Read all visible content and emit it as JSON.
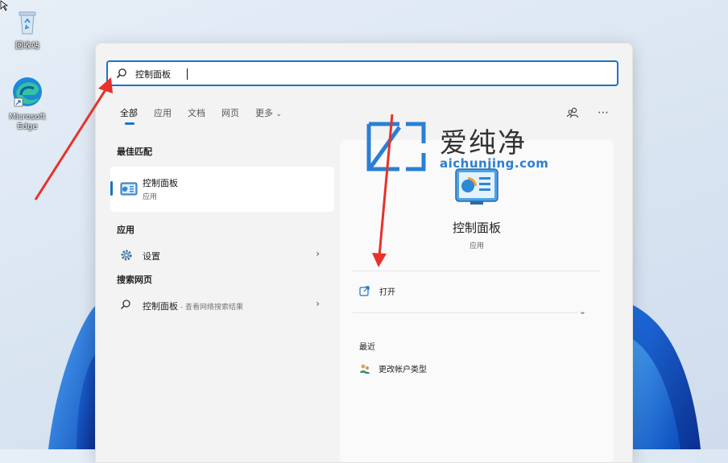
{
  "desktop": {
    "icons": [
      {
        "name": "recycle-bin",
        "label": "回收站"
      },
      {
        "name": "microsoft-edge",
        "label": "Microsoft Edge"
      }
    ]
  },
  "search": {
    "value": "控制面板",
    "icon": "search-icon"
  },
  "tabs": [
    {
      "label": "全部",
      "active": true
    },
    {
      "label": "应用"
    },
    {
      "label": "文档"
    },
    {
      "label": "网页"
    },
    {
      "label": "更多"
    }
  ],
  "toolbar": {
    "account_icon": "account-switch-icon",
    "more_icon": "more-options-icon"
  },
  "best_match": {
    "heading": "最佳匹配",
    "title": "控制面板",
    "subtitle": "应用"
  },
  "apps": {
    "heading": "应用",
    "items": [
      {
        "label": "设置",
        "icon": "gear-icon"
      }
    ]
  },
  "web": {
    "heading": "搜索网页",
    "items": [
      {
        "label": "控制面板",
        "sub": " - 查看网络搜索结果",
        "icon": "search-icon"
      }
    ]
  },
  "detail": {
    "title": "控制面板",
    "subtitle": "应用",
    "actions": [
      {
        "label": "打开",
        "icon": "open-icon"
      }
    ],
    "recent_heading": "最近",
    "recent": [
      {
        "label": "更改帐户类型",
        "icon": "users-icon"
      }
    ]
  },
  "watermark": {
    "title": "爱纯净",
    "url": "aichunjing.com"
  },
  "colors": {
    "accent": "#1a73c8",
    "arrow": "#e8312a",
    "watermark_blue": "#2a7fd4"
  }
}
